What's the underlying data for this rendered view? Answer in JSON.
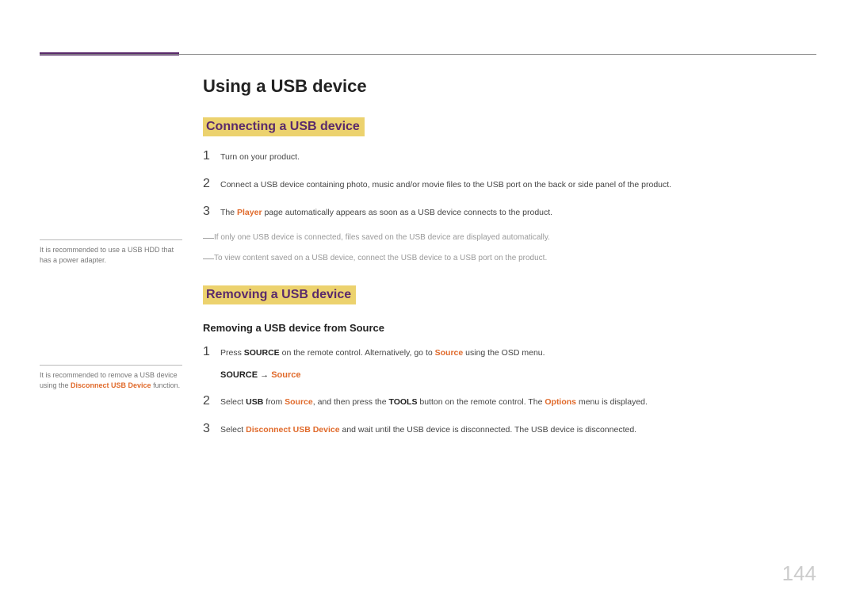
{
  "title": "Using a USB device",
  "section1": {
    "heading": "Connecting a USB device",
    "steps": [
      {
        "num": "1",
        "text": "Turn on your product."
      },
      {
        "num": "2",
        "text": "Connect a USB device containing photo, music and/or movie files to the USB port on the back or side panel of the product."
      },
      {
        "num": "3",
        "pre": "The ",
        "em": "Player",
        "post": " page automatically appears as soon as a USB device connects to the product."
      }
    ],
    "notes": [
      "If only one USB device is connected, files saved on the USB device are displayed automatically.",
      "To view content saved on a USB device, connect the USB device to a USB port on the product."
    ]
  },
  "section2": {
    "heading": "Removing a USB device",
    "subheading": "Removing a USB device from Source",
    "step1": {
      "num": "1",
      "pre": "Press ",
      "b1": "SOURCE",
      "mid": " on the remote control. Alternatively, go to ",
      "em": "Source",
      "post": " using the OSD menu."
    },
    "path": {
      "b": "SOURCE",
      "arrow": " → ",
      "em": "Source"
    },
    "step2": {
      "num": "2",
      "t1": "Select ",
      "b1": "USB",
      "t2": " from ",
      "em1": "Source",
      "t3": ", and then press the ",
      "b2": "TOOLS",
      "t4": " button on the remote control. The ",
      "em2": "Options",
      "t5": " menu is displayed."
    },
    "step3": {
      "num": "3",
      "t1": "Select ",
      "em": "Disconnect USB Device",
      "t2": " and wait until the USB device is disconnected. The USB device is disconnected."
    }
  },
  "sidebar1": "It is recommended to use a USB HDD that has a power adapter.",
  "sidebar2": {
    "pre": "It is recommended to remove a USB device using the ",
    "em": "Disconnect USB Device",
    "post": " function."
  },
  "pagenum": "144"
}
